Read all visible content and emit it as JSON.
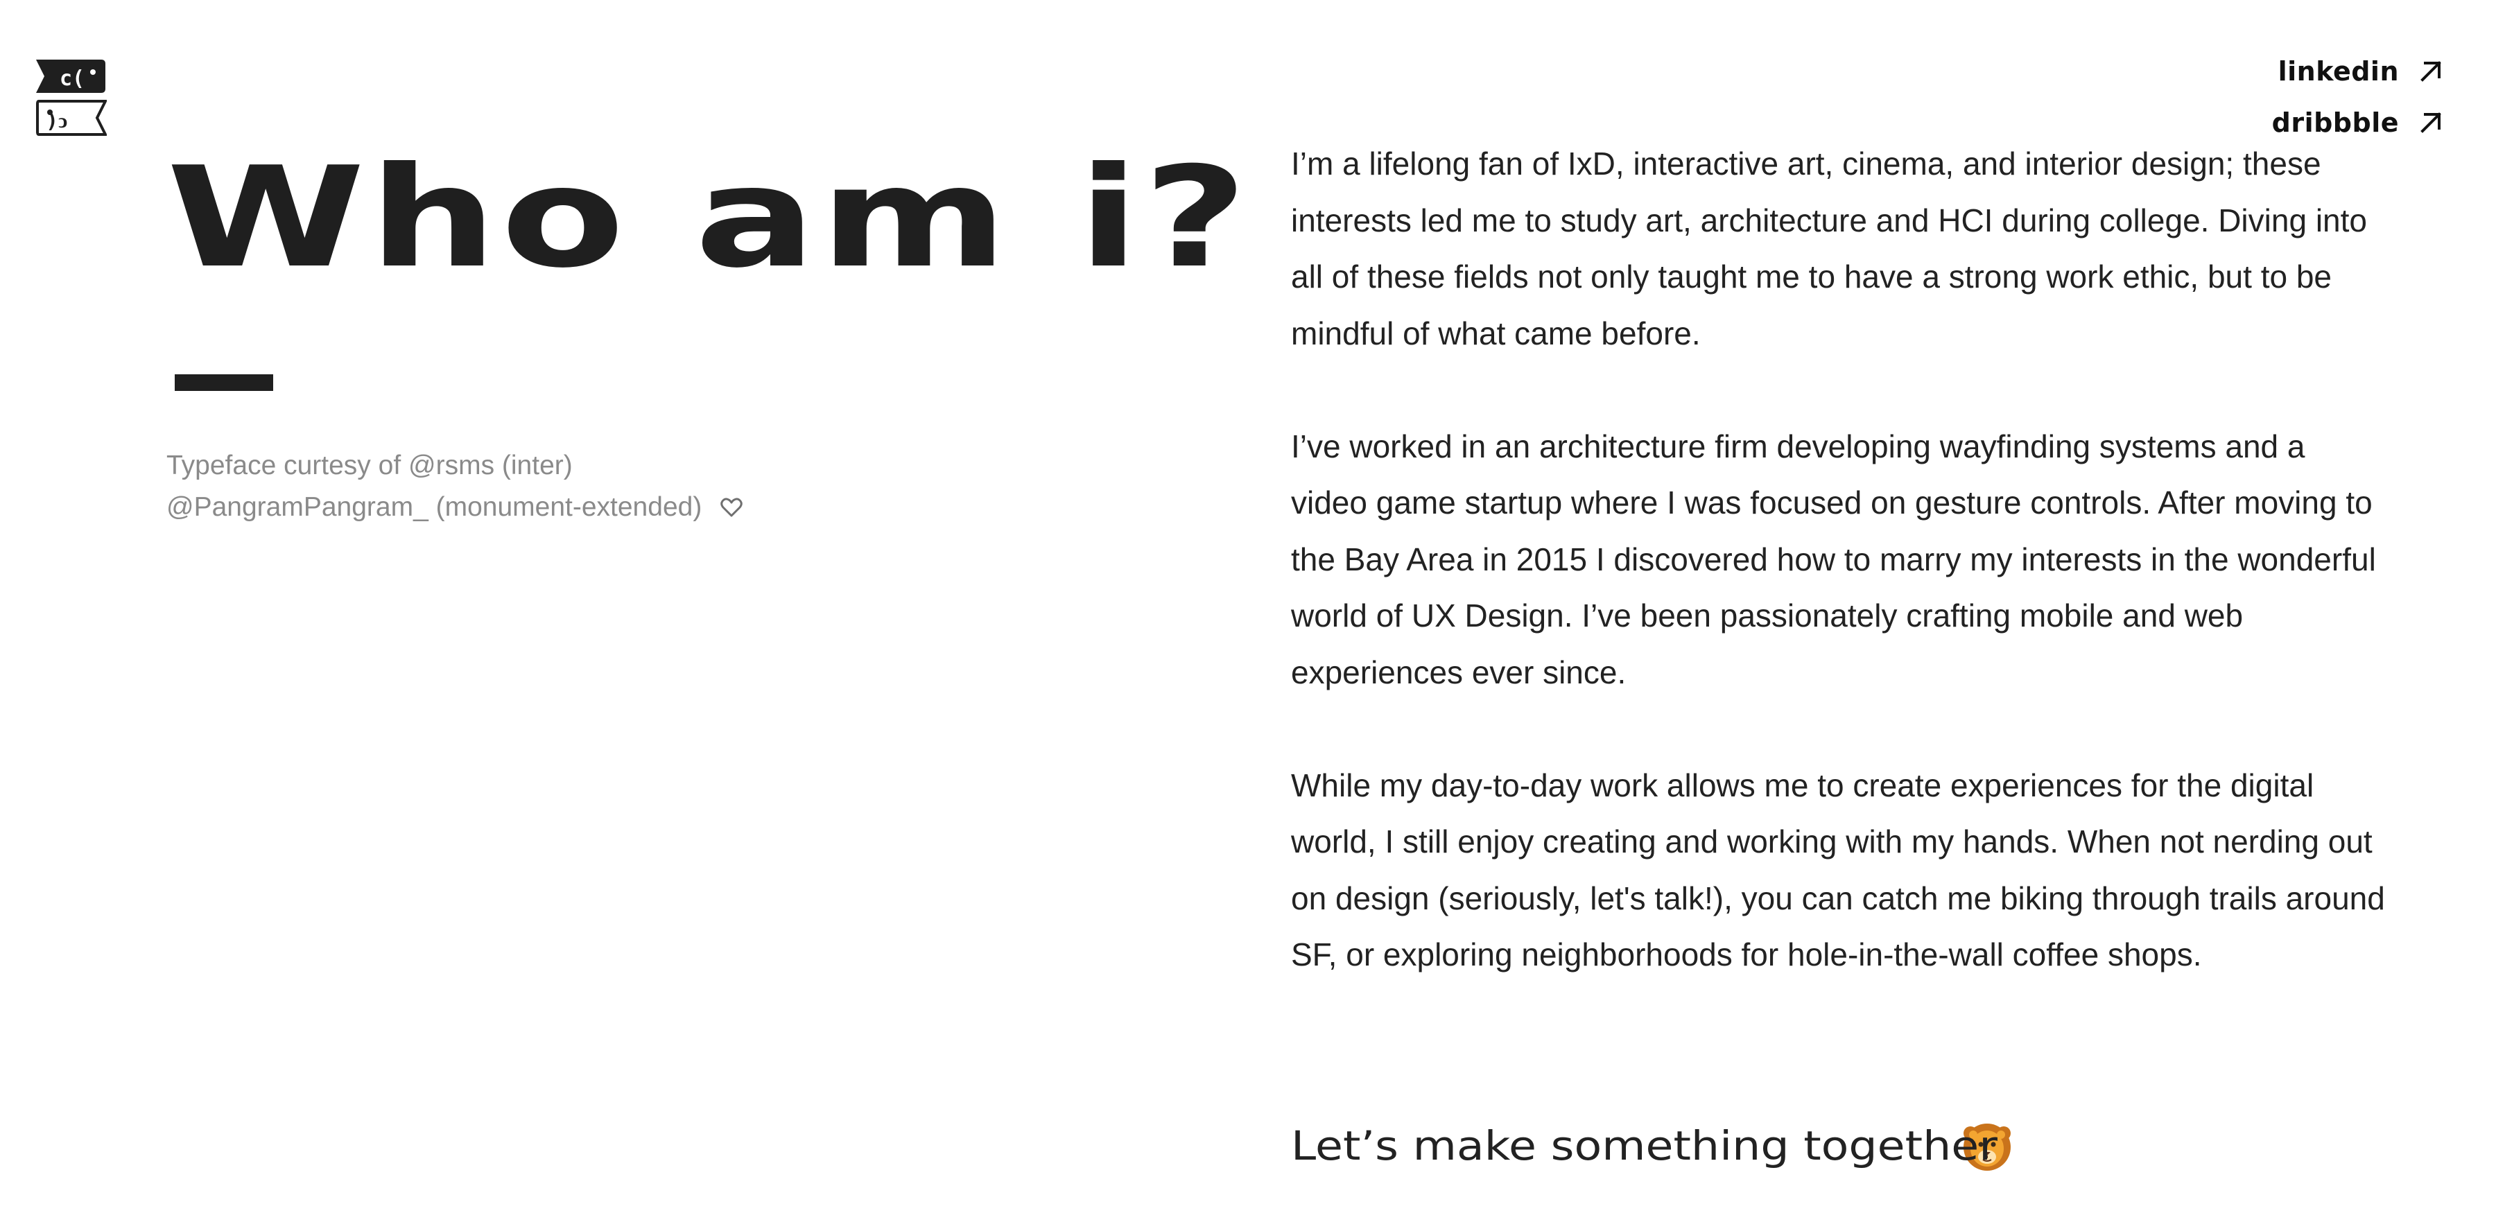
{
  "header": {
    "logo_icon": "ticket-face-logo-icon",
    "social": [
      {
        "label": "linkedin",
        "icon": "arrow-up-right-icon"
      },
      {
        "label": "dribbble",
        "icon": "arrow-up-right-icon"
      }
    ]
  },
  "intro": {
    "title": "Who am i?",
    "credit_line1": "Typeface curtesy of @rsms (inter)",
    "credit_line2": "@PangramPangram_ (monument-extended)",
    "credit_icon": "heart-icon"
  },
  "bio": {
    "paragraphs": [
      "I’m a lifelong fan of IxD, interactive art, cinema, and interior design; these interests led me to study art, architecture and HCI during college. Diving into all of these fields not only taught me to have a strong work ethic, but to be mindful of what came before.",
      "I’ve worked in an architecture firm developing wayfinding systems and a video game startup where I was focused on gesture controls. After moving to the Bay Area in 2015 I discovered how to marry my interests in the wonderful world of UX Design. I’ve been passionately crafting mobile and web experiences ever since.",
      "While my day-to-day work allows me to create experiences for the digital world, I still enjoy creating and working with my hands. When not nerding out on design (seriously, let's talk!), you can catch me biking through trails around SF, or exploring neighborhoods for hole-in-the-wall coffee shops."
    ]
  },
  "cta": {
    "text": "Let’s make something together",
    "icon": "lion-face-icon"
  },
  "colors": {
    "text": "#1f1f1f",
    "muted": "#8a8a8a",
    "background": "#ffffff",
    "lion_orange": "#f3a531"
  }
}
